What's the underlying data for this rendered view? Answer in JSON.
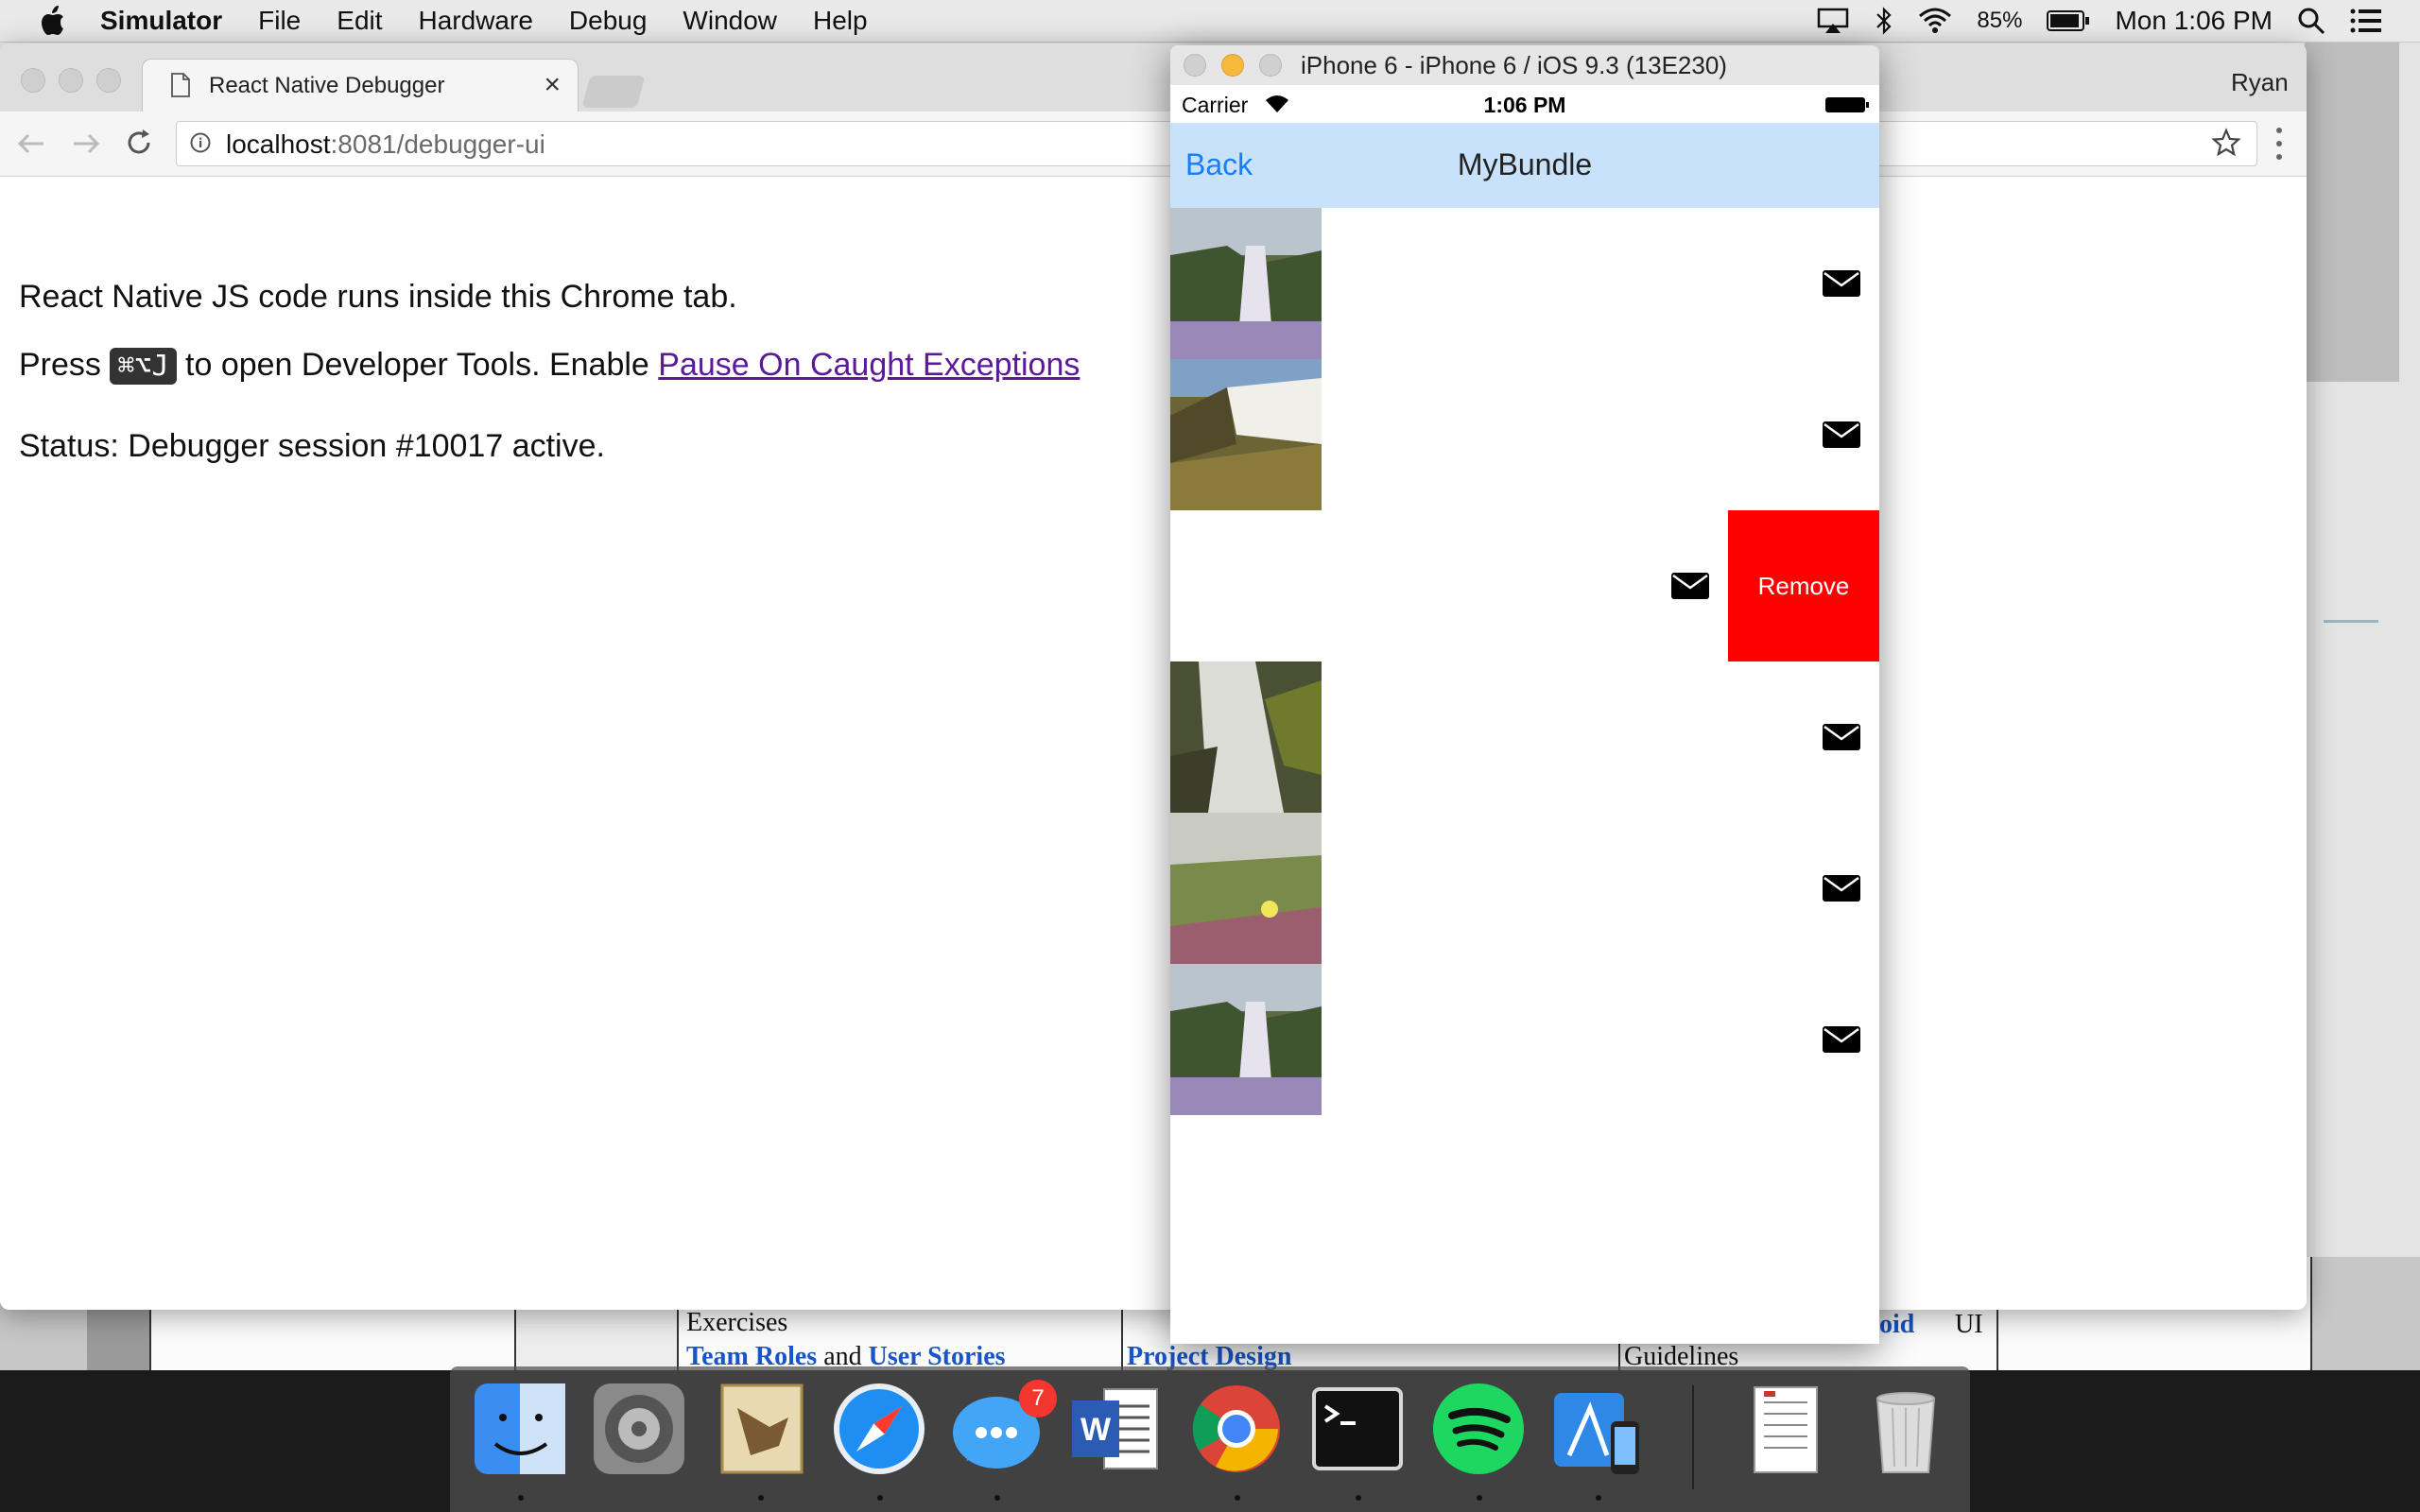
{
  "menubar": {
    "app_name": "Simulator",
    "menus": [
      "File",
      "Edit",
      "Hardware",
      "Debug",
      "Window",
      "Help"
    ],
    "battery": "85%",
    "clock": "Mon 1:06 PM"
  },
  "chrome": {
    "tab_title": "React Native Debugger",
    "tab_close": "×",
    "profile": "Ryan",
    "url_host": "localhost",
    "url_path": ":8081/debugger-ui",
    "content": {
      "line1": "React Native JS code runs inside this Chrome tab.",
      "line2_prefix": "Press",
      "line2_kbd": "⌘⌥J",
      "line2_middle": "to open Developer Tools. Enable",
      "line2_link": "Pause On Caught Exceptions",
      "line3": "Status: Debugger session #10017 active."
    }
  },
  "simulator": {
    "window_title": "iPhone 6 - iPhone 6 / iOS 9.3 (13E230)",
    "status_carrier": "Carrier",
    "status_time": "1:06 PM",
    "nav_back": "Back",
    "nav_title": "MyBundle",
    "rows": [
      {
        "thumb": "waterfall-cliff",
        "has_image": true
      },
      {
        "thumb": "waterfall-river",
        "has_image": true
      },
      {
        "thumb": "",
        "has_image": false,
        "swiped": true,
        "action": "Remove"
      },
      {
        "thumb": "cascade-moss",
        "has_image": true
      },
      {
        "thumb": "yellow-flower",
        "has_image": true
      },
      {
        "thumb": "waterfall-cliff",
        "has_image": true
      }
    ],
    "remove_label": "Remove",
    "colors": {
      "nav_bg": "#c9e2fb",
      "back_link": "#147efb",
      "remove_bg": "#ff0000"
    }
  },
  "background_doc": {
    "exercises": "Exercises",
    "team_roles": "Team Roles",
    "and": "and",
    "user_stories": "User Stories",
    "project_design": "Project Design",
    "android_frag": "oid",
    "ui": "UI",
    "guidelines": "Guidelines"
  },
  "dock": {
    "apps": [
      "finder-icon",
      "system-preferences-icon",
      "mail-icon",
      "safari-icon",
      "messages-icon",
      "word-icon",
      "chrome-icon",
      "terminal-icon",
      "spotify-icon",
      "xcode-simulator-icon",
      "preview-document-icon",
      "trash-icon"
    ],
    "messages_badge": "7"
  }
}
